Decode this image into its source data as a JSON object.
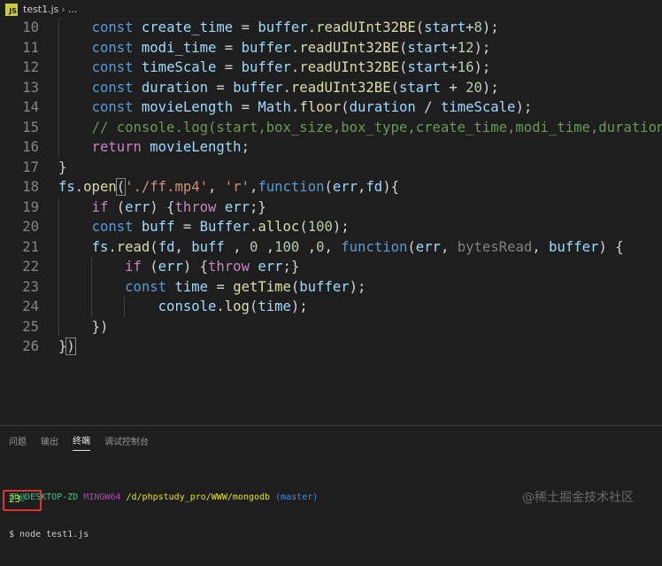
{
  "breadcrumb": {
    "icon_label": "JS",
    "file": "test1.js",
    "separator": "›",
    "more": "..."
  },
  "editor": {
    "lines": [
      {
        "num": "10",
        "tokens": [
          {
            "t": "    ",
            "c": ""
          },
          {
            "t": "const",
            "c": "kw"
          },
          {
            "t": " ",
            "c": ""
          },
          {
            "t": "create_time",
            "c": "var"
          },
          {
            "t": " = ",
            "c": ""
          },
          {
            "t": "buffer",
            "c": "var"
          },
          {
            "t": ".",
            "c": ""
          },
          {
            "t": "readUInt32BE",
            "c": "fn"
          },
          {
            "t": "(",
            "c": ""
          },
          {
            "t": "start",
            "c": "var"
          },
          {
            "t": "+",
            "c": ""
          },
          {
            "t": "8",
            "c": "num"
          },
          {
            "t": ");",
            "c": ""
          }
        ]
      },
      {
        "num": "11",
        "tokens": [
          {
            "t": "    ",
            "c": ""
          },
          {
            "t": "const",
            "c": "kw"
          },
          {
            "t": " ",
            "c": ""
          },
          {
            "t": "modi_time",
            "c": "var"
          },
          {
            "t": " = ",
            "c": ""
          },
          {
            "t": "buffer",
            "c": "var"
          },
          {
            "t": ".",
            "c": ""
          },
          {
            "t": "readUInt32BE",
            "c": "fn"
          },
          {
            "t": "(",
            "c": ""
          },
          {
            "t": "start",
            "c": "var"
          },
          {
            "t": "+",
            "c": ""
          },
          {
            "t": "12",
            "c": "num"
          },
          {
            "t": ");",
            "c": ""
          }
        ]
      },
      {
        "num": "12",
        "tokens": [
          {
            "t": "    ",
            "c": ""
          },
          {
            "t": "const",
            "c": "kw"
          },
          {
            "t": " ",
            "c": ""
          },
          {
            "t": "timeScale",
            "c": "var"
          },
          {
            "t": " = ",
            "c": ""
          },
          {
            "t": "buffer",
            "c": "var"
          },
          {
            "t": ".",
            "c": ""
          },
          {
            "t": "readUInt32BE",
            "c": "fn"
          },
          {
            "t": "(",
            "c": ""
          },
          {
            "t": "start",
            "c": "var"
          },
          {
            "t": "+",
            "c": ""
          },
          {
            "t": "16",
            "c": "num"
          },
          {
            "t": ");",
            "c": ""
          }
        ]
      },
      {
        "num": "13",
        "tokens": [
          {
            "t": "    ",
            "c": ""
          },
          {
            "t": "const",
            "c": "kw"
          },
          {
            "t": " ",
            "c": ""
          },
          {
            "t": "duration",
            "c": "var"
          },
          {
            "t": " = ",
            "c": ""
          },
          {
            "t": "buffer",
            "c": "var"
          },
          {
            "t": ".",
            "c": ""
          },
          {
            "t": "readUInt32BE",
            "c": "fn"
          },
          {
            "t": "(",
            "c": ""
          },
          {
            "t": "start",
            "c": "var"
          },
          {
            "t": " + ",
            "c": ""
          },
          {
            "t": "20",
            "c": "num"
          },
          {
            "t": ");",
            "c": ""
          }
        ]
      },
      {
        "num": "14",
        "tokens": [
          {
            "t": "    ",
            "c": ""
          },
          {
            "t": "const",
            "c": "kw"
          },
          {
            "t": " ",
            "c": ""
          },
          {
            "t": "movieLength",
            "c": "var"
          },
          {
            "t": " = ",
            "c": ""
          },
          {
            "t": "Math",
            "c": "var"
          },
          {
            "t": ".",
            "c": ""
          },
          {
            "t": "floor",
            "c": "fn"
          },
          {
            "t": "(",
            "c": ""
          },
          {
            "t": "duration",
            "c": "var"
          },
          {
            "t": " / ",
            "c": ""
          },
          {
            "t": "timeScale",
            "c": "var"
          },
          {
            "t": ");",
            "c": ""
          }
        ]
      },
      {
        "num": "15",
        "tokens": [
          {
            "t": "    ",
            "c": ""
          },
          {
            "t": "// console.log(start,box_size,box_type,create_time,modi_time,duration,t",
            "c": "cmt"
          }
        ]
      },
      {
        "num": "16",
        "tokens": [
          {
            "t": "    ",
            "c": ""
          },
          {
            "t": "return",
            "c": "kw2"
          },
          {
            "t": " ",
            "c": ""
          },
          {
            "t": "movieLength",
            "c": "var"
          },
          {
            "t": ";",
            "c": ""
          }
        ]
      },
      {
        "num": "17",
        "tokens": [
          {
            "t": "}",
            "c": ""
          }
        ]
      },
      {
        "num": "18",
        "tokens": [
          {
            "t": "fs",
            "c": "var"
          },
          {
            "t": ".",
            "c": ""
          },
          {
            "t": "open",
            "c": "fn"
          },
          {
            "t": "(",
            "c": "bm"
          },
          {
            "t": "'./ff.mp4'",
            "c": "str"
          },
          {
            "t": ", ",
            "c": ""
          },
          {
            "t": "'r'",
            "c": "str"
          },
          {
            "t": ",",
            "c": ""
          },
          {
            "t": "function",
            "c": "kw"
          },
          {
            "t": "(",
            "c": ""
          },
          {
            "t": "err",
            "c": "param"
          },
          {
            "t": ",",
            "c": ""
          },
          {
            "t": "fd",
            "c": "param"
          },
          {
            "t": "){",
            "c": ""
          }
        ]
      },
      {
        "num": "19",
        "tokens": [
          {
            "t": "    ",
            "c": ""
          },
          {
            "t": "if",
            "c": "kw2"
          },
          {
            "t": " (",
            "c": ""
          },
          {
            "t": "err",
            "c": "var"
          },
          {
            "t": ") {",
            "c": ""
          },
          {
            "t": "throw",
            "c": "kw2"
          },
          {
            "t": " ",
            "c": ""
          },
          {
            "t": "err",
            "c": "var"
          },
          {
            "t": ";}",
            "c": ""
          }
        ]
      },
      {
        "num": "20",
        "tokens": [
          {
            "t": "    ",
            "c": ""
          },
          {
            "t": "const",
            "c": "kw"
          },
          {
            "t": " ",
            "c": ""
          },
          {
            "t": "buff",
            "c": "var"
          },
          {
            "t": " = ",
            "c": ""
          },
          {
            "t": "Buffer",
            "c": "var"
          },
          {
            "t": ".",
            "c": ""
          },
          {
            "t": "alloc",
            "c": "fn"
          },
          {
            "t": "(",
            "c": ""
          },
          {
            "t": "100",
            "c": "num"
          },
          {
            "t": ");",
            "c": ""
          }
        ]
      },
      {
        "num": "21",
        "tokens": [
          {
            "t": "    ",
            "c": ""
          },
          {
            "t": "fs",
            "c": "var"
          },
          {
            "t": ".",
            "c": ""
          },
          {
            "t": "read",
            "c": "fn"
          },
          {
            "t": "(",
            "c": ""
          },
          {
            "t": "fd",
            "c": "var"
          },
          {
            "t": ", ",
            "c": ""
          },
          {
            "t": "buff",
            "c": "var"
          },
          {
            "t": " , ",
            "c": ""
          },
          {
            "t": "0",
            "c": "num"
          },
          {
            "t": " ,",
            "c": ""
          },
          {
            "t": "100",
            "c": "num"
          },
          {
            "t": " ,",
            "c": ""
          },
          {
            "t": "0",
            "c": "num"
          },
          {
            "t": ", ",
            "c": ""
          },
          {
            "t": "function",
            "c": "kw"
          },
          {
            "t": "(",
            "c": ""
          },
          {
            "t": "err",
            "c": "param"
          },
          {
            "t": ", ",
            "c": ""
          },
          {
            "t": "bytesRead",
            "c": "pr"
          },
          {
            "t": ", ",
            "c": ""
          },
          {
            "t": "buffer",
            "c": "param"
          },
          {
            "t": ") {",
            "c": ""
          }
        ]
      },
      {
        "num": "22",
        "tokens": [
          {
            "t": "        ",
            "c": ""
          },
          {
            "t": "if",
            "c": "kw2"
          },
          {
            "t": " (",
            "c": ""
          },
          {
            "t": "err",
            "c": "var"
          },
          {
            "t": ") {",
            "c": ""
          },
          {
            "t": "throw",
            "c": "kw2"
          },
          {
            "t": " ",
            "c": ""
          },
          {
            "t": "err",
            "c": "var"
          },
          {
            "t": ";}",
            "c": ""
          }
        ]
      },
      {
        "num": "23",
        "tokens": [
          {
            "t": "        ",
            "c": ""
          },
          {
            "t": "const",
            "c": "kw"
          },
          {
            "t": " ",
            "c": ""
          },
          {
            "t": "time",
            "c": "var"
          },
          {
            "t": " = ",
            "c": ""
          },
          {
            "t": "getTime",
            "c": "fn"
          },
          {
            "t": "(",
            "c": ""
          },
          {
            "t": "buffer",
            "c": "var"
          },
          {
            "t": ");",
            "c": ""
          }
        ]
      },
      {
        "num": "24",
        "tokens": [
          {
            "t": "            ",
            "c": ""
          },
          {
            "t": "console",
            "c": "var"
          },
          {
            "t": ".",
            "c": ""
          },
          {
            "t": "log",
            "c": "fn"
          },
          {
            "t": "(",
            "c": ""
          },
          {
            "t": "time",
            "c": "var"
          },
          {
            "t": ");",
            "c": ""
          }
        ]
      },
      {
        "num": "25",
        "tokens": [
          {
            "t": "    ",
            "c": ""
          },
          {
            "t": "})",
            "c": ""
          }
        ]
      },
      {
        "num": "26",
        "tokens": [
          {
            "t": "}",
            "c": ""
          },
          {
            "t": ")",
            "c": "bm"
          }
        ]
      }
    ]
  },
  "panel": {
    "tabs": [
      {
        "label": "问题",
        "active": false
      },
      {
        "label": "输出",
        "active": false
      },
      {
        "label": "终端",
        "active": true
      },
      {
        "label": "调试控制台",
        "active": false
      }
    ],
    "terminal": {
      "user": "ZD@DESKTOP-ZD",
      "host": "MINGW64",
      "path": "/d/phpstudy_pro/WWW/mongodb",
      "branch": "(master)",
      "command": "$ node test1.js",
      "output": "23"
    },
    "watermark": "@稀土掘金技术社区"
  }
}
